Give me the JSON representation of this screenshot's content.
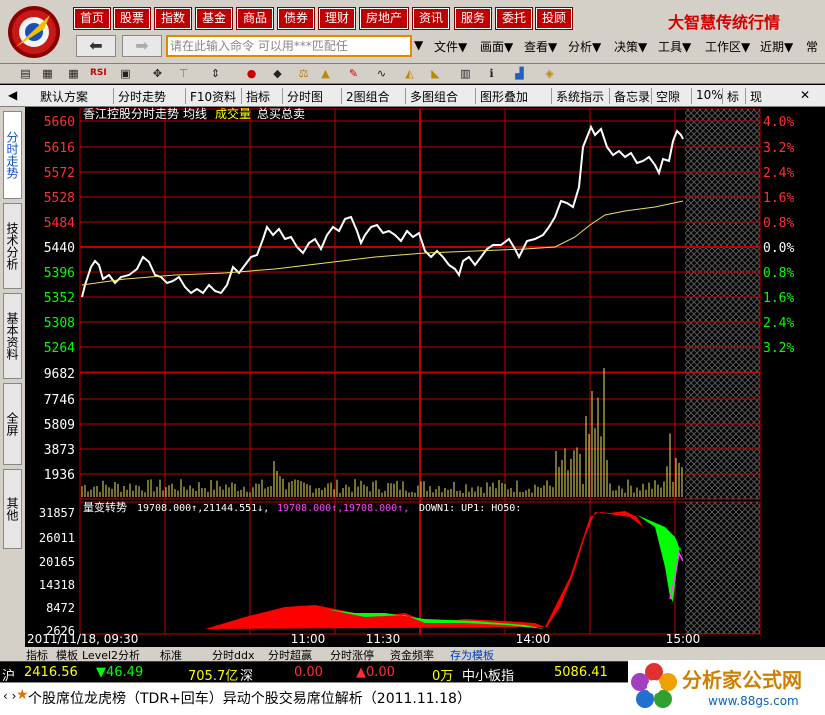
{
  "top_nav": [
    "首页",
    "股票",
    "指数",
    "基金",
    "商品",
    "债券",
    "理财",
    "房地产",
    "资讯",
    "服务",
    "委托",
    "投顾"
  ],
  "brand": "大智慧传统行情",
  "command_placeholder": "请在此输入命令   可以用***匹配任",
  "menus": [
    "文件▼",
    "画面▼",
    "查看▼",
    "分析▼",
    "决策▼",
    "工具▼",
    "工作区▼",
    "近期▼",
    "常"
  ],
  "tabs": [
    "默认方案",
    "分时走势",
    "F10资料",
    "指标",
    "分时图",
    "2图组合",
    "多图组合",
    "图形叠加",
    "系统指示",
    "备忘录",
    "空隙",
    "10%",
    "标",
    "现"
  ],
  "left_tabs": [
    "分时走势",
    "技术分析",
    "基本资料",
    "全屏",
    "其他"
  ],
  "chart": {
    "stock_title": "香江控股分时走势",
    "legend_avg": "均线",
    "legend_vol": "成交量",
    "legend_total": "总买总卖",
    "price_ticks": [
      "5660",
      "5616",
      "5572",
      "5528",
      "5484",
      "5440",
      "5396",
      "5352",
      "5308",
      "5264"
    ],
    "pct_ticks": [
      "4.0%",
      "3.2%",
      "2.4%",
      "1.6%",
      "0.8%",
      "0.0%",
      "0.8%",
      "1.6%",
      "2.4%",
      "3.2%"
    ],
    "vol_ticks": [
      "9682",
      "7746",
      "5809",
      "3873",
      "1936"
    ],
    "ind_ticks": [
      "31857",
      "26011",
      "20165",
      "14318",
      "8472",
      "2626"
    ],
    "indicator_name": "量变转势",
    "ind_v1": "19708.000↑,",
    "ind_v2": "21144.551↓,",
    "ind_v3": "19708.000↑,",
    "ind_v4": "19708.000↑,",
    "ind_v5": "DOWN1: UP1: HO50:",
    "time_labels": [
      "2011/11/18, 09:30",
      "11:00",
      "11:30",
      "14:00",
      "15:00"
    ]
  },
  "bottom_tabs": [
    "指标",
    "模板",
    "Level2分析",
    "标准",
    "分时ddx",
    "分时超赢",
    "分时涨停",
    "资金频率",
    "存为模板"
  ],
  "status": {
    "sh_label": "沪",
    "sh_index": "2416.56",
    "sh_change": "▼46.49",
    "sh_amount": "705.7亿",
    "sz_label": "深",
    "sz_index": "0.00",
    "sz_change": "▲0.00",
    "sz_amount": "0万",
    "zxb_label": "中小板指",
    "zxb_index": "5086.41"
  },
  "ticker": "个股席位龙虎榜（TDR+回车）异动个股交易席位解析（2011.11.18）",
  "watermark": "分析家公式网",
  "watermark_url": "www.88gs.com"
}
